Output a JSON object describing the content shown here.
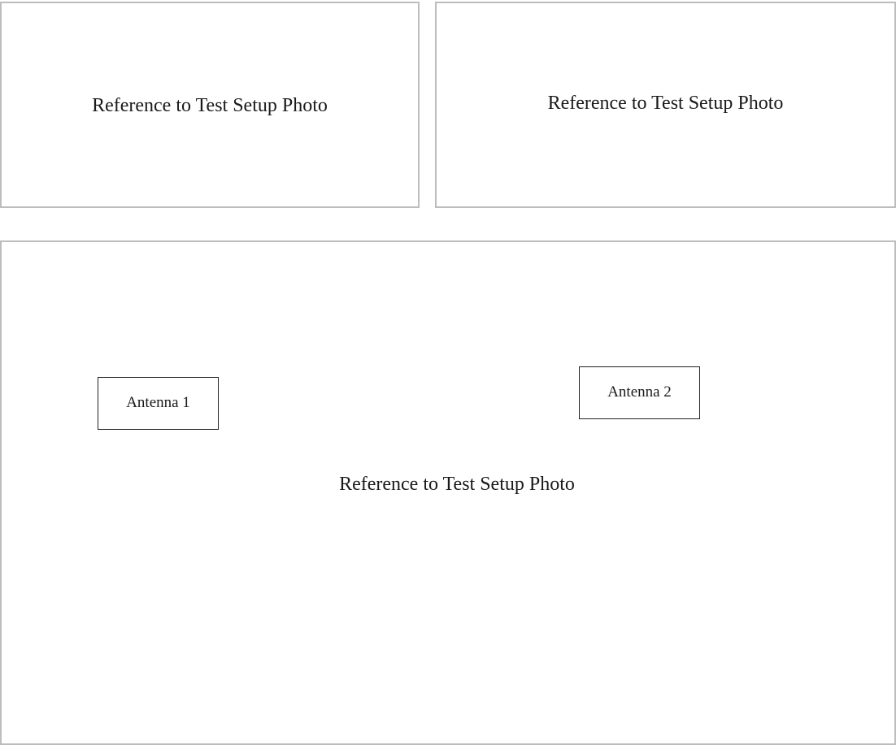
{
  "panels": {
    "top_left": {
      "caption": "Reference to Test Setup Photo"
    },
    "top_right": {
      "caption": "Reference to Test Setup Photo"
    },
    "bottom": {
      "caption": "Reference to Test Setup Photo",
      "labels": [
        "Antenna 1",
        "Antenna 2"
      ]
    }
  }
}
